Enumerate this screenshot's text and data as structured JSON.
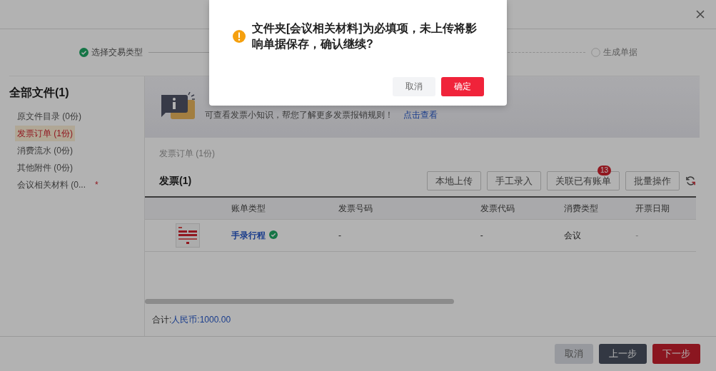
{
  "steps": [
    {
      "label": "选择交易类型",
      "done": true
    },
    {
      "label": "生成单据",
      "done": false
    }
  ],
  "sidebar": {
    "title": "全部文件(1)",
    "items": [
      {
        "label": "原文件目录 (0份)",
        "selected": false
      },
      {
        "label": "发票订单 (1份)",
        "selected": true
      },
      {
        "label": "消费流水 (0份)",
        "selected": false
      },
      {
        "label": "其他附件 (0份)",
        "selected": false
      },
      {
        "label": "会议相关材料 (0...",
        "selected": false,
        "required_mark": "*"
      }
    ]
  },
  "tip": {
    "text": "可查看发票小知识，帮您了解更多发票报销规则！",
    "link": "点击查看"
  },
  "breadcrumb": "发票订单 (1份)",
  "section": {
    "title": "发票(1)",
    "buttons": [
      {
        "label": "本地上传"
      },
      {
        "label": "手工录入"
      },
      {
        "label": "关联已有账单",
        "badge": "13"
      },
      {
        "label": "批量操作"
      }
    ]
  },
  "table": {
    "columns": [
      "",
      "账单类型",
      "发票号码",
      "发票代码",
      "消费类型",
      "开票日期"
    ],
    "rows": [
      {
        "bill_type": "手录行程",
        "verified": true,
        "invoice_number": "-",
        "invoice_code": "-",
        "consumption_type": "会议",
        "invoice_date": "-"
      }
    ]
  },
  "total": {
    "label": "合计:",
    "value": "人民币:1000.00"
  },
  "footer": {
    "buttons": [
      {
        "label": "取消",
        "kind": "plain"
      },
      {
        "label": "上一步",
        "kind": "dark"
      },
      {
        "label": "下一步",
        "kind": "primary"
      }
    ]
  },
  "dialog": {
    "message": "文件夹[会议相关材料]为必填项，未上传将影响单据保存，确认继续?",
    "buttons": [
      {
        "label": "取消",
        "kind": "plain"
      },
      {
        "label": "确定",
        "kind": "primary"
      }
    ]
  }
}
